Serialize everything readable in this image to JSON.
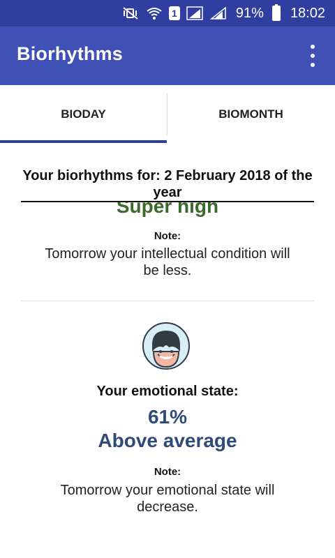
{
  "status_bar": {
    "battery": "91%",
    "time": "18:02",
    "sim_label": "1",
    "icons": [
      "vibrate-mute-icon",
      "wifi-icon",
      "sim-icon",
      "signal-icon",
      "signal-icon",
      "battery-charging-icon"
    ]
  },
  "app_bar": {
    "title": "Biorhythms",
    "menu_icon": "overflow-menu-icon"
  },
  "tabs": [
    {
      "label": "BIODAY",
      "selected": true
    },
    {
      "label": "BIOMONTH",
      "selected": false
    }
  ],
  "content": {
    "heading": "Your biorhythms for: 2 February 2018 of the year",
    "intellectual": {
      "level": "Super high",
      "note_label": "Note:",
      "note": "Tomorrow your intellectual condition will be less."
    },
    "emotional": {
      "icon": "smiling-face-avatar-icon",
      "title": "Your emotional state:",
      "percent": "61%",
      "level": "Above average",
      "note_label": "Note:",
      "note": "Tomorrow your emotional state will decrease."
    }
  },
  "colors": {
    "status_bar": "#303f9f",
    "app_bar": "#3f51b5",
    "tab_indicator": "#303f9f",
    "intellectual_level": "#3a6b2a",
    "emotional_value": "#2e4b78"
  }
}
